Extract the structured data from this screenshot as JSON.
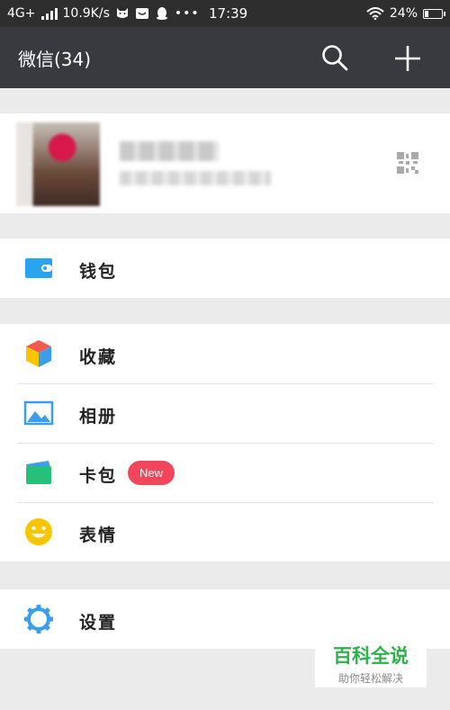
{
  "status_bar": {
    "network": "4G+",
    "speed": "10.9K/s",
    "time": "17:39",
    "dots": "•••",
    "battery": "24%",
    "battery_level": 0.24
  },
  "header": {
    "title": "微信(34)",
    "search_icon": "search-icon",
    "add_icon": "plus-icon"
  },
  "profile": {
    "avatar": "avatar",
    "qr_icon": "qr-code-icon"
  },
  "menu": {
    "wallet": {
      "label": "钱包",
      "icon": "wallet-icon",
      "color": "#2aa4ef"
    },
    "favorites": {
      "label": "收藏",
      "icon": "favorites-cube-icon"
    },
    "album": {
      "label": "相册",
      "icon": "album-image-icon",
      "color": "#3a9ded"
    },
    "cards": {
      "label": "卡包",
      "icon": "card-pack-icon",
      "badge": "New",
      "badge_color": "#f2475a"
    },
    "stickers": {
      "label": "表情",
      "icon": "smiley-icon",
      "color": "#f7c600"
    },
    "settings": {
      "label": "设置",
      "icon": "gear-icon",
      "color": "#3a9ded"
    }
  },
  "watermark": {
    "brand": "百科全说",
    "tagline": "助你轻松解决"
  }
}
